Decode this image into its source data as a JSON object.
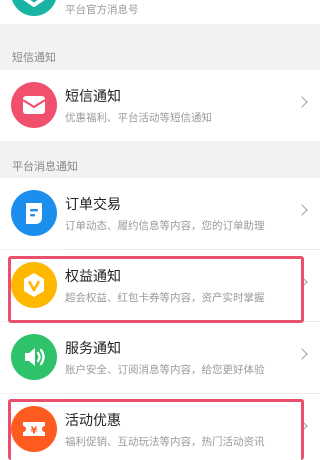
{
  "top_item": {
    "subtitle": "平台官方消息号",
    "icon": "official-star-icon",
    "color": "#19b4a4"
  },
  "sms_section": {
    "title": "短信通知"
  },
  "sms_item": {
    "title": "短信通知",
    "subtitle": "优惠福利、平台活动等短信通知",
    "icon": "envelope-icon",
    "color": "#f0506e"
  },
  "platform_section": {
    "title": "平台消息通知"
  },
  "items": [
    {
      "title": "订单交易",
      "subtitle": "订单动态、履约信息等内容，您的订单助理",
      "icon": "order-doc-icon",
      "color": "#1c8fee"
    },
    {
      "title": "权益通知",
      "subtitle": "超会权益、红包卡券等内容，资产实时掌握",
      "icon": "vip-badge-icon",
      "color": "#ffb800"
    },
    {
      "title": "服务通知",
      "subtitle": "账户安全、订阅消息等内容，给您更好体验",
      "icon": "speaker-icon",
      "color": "#2ec26a"
    },
    {
      "title": "活动优惠",
      "subtitle": "福利促销、互动玩法等内容，热门活动资讯",
      "icon": "coupon-icon",
      "color": "#ff5a1f"
    }
  ],
  "highlight_color": "#e8506c"
}
